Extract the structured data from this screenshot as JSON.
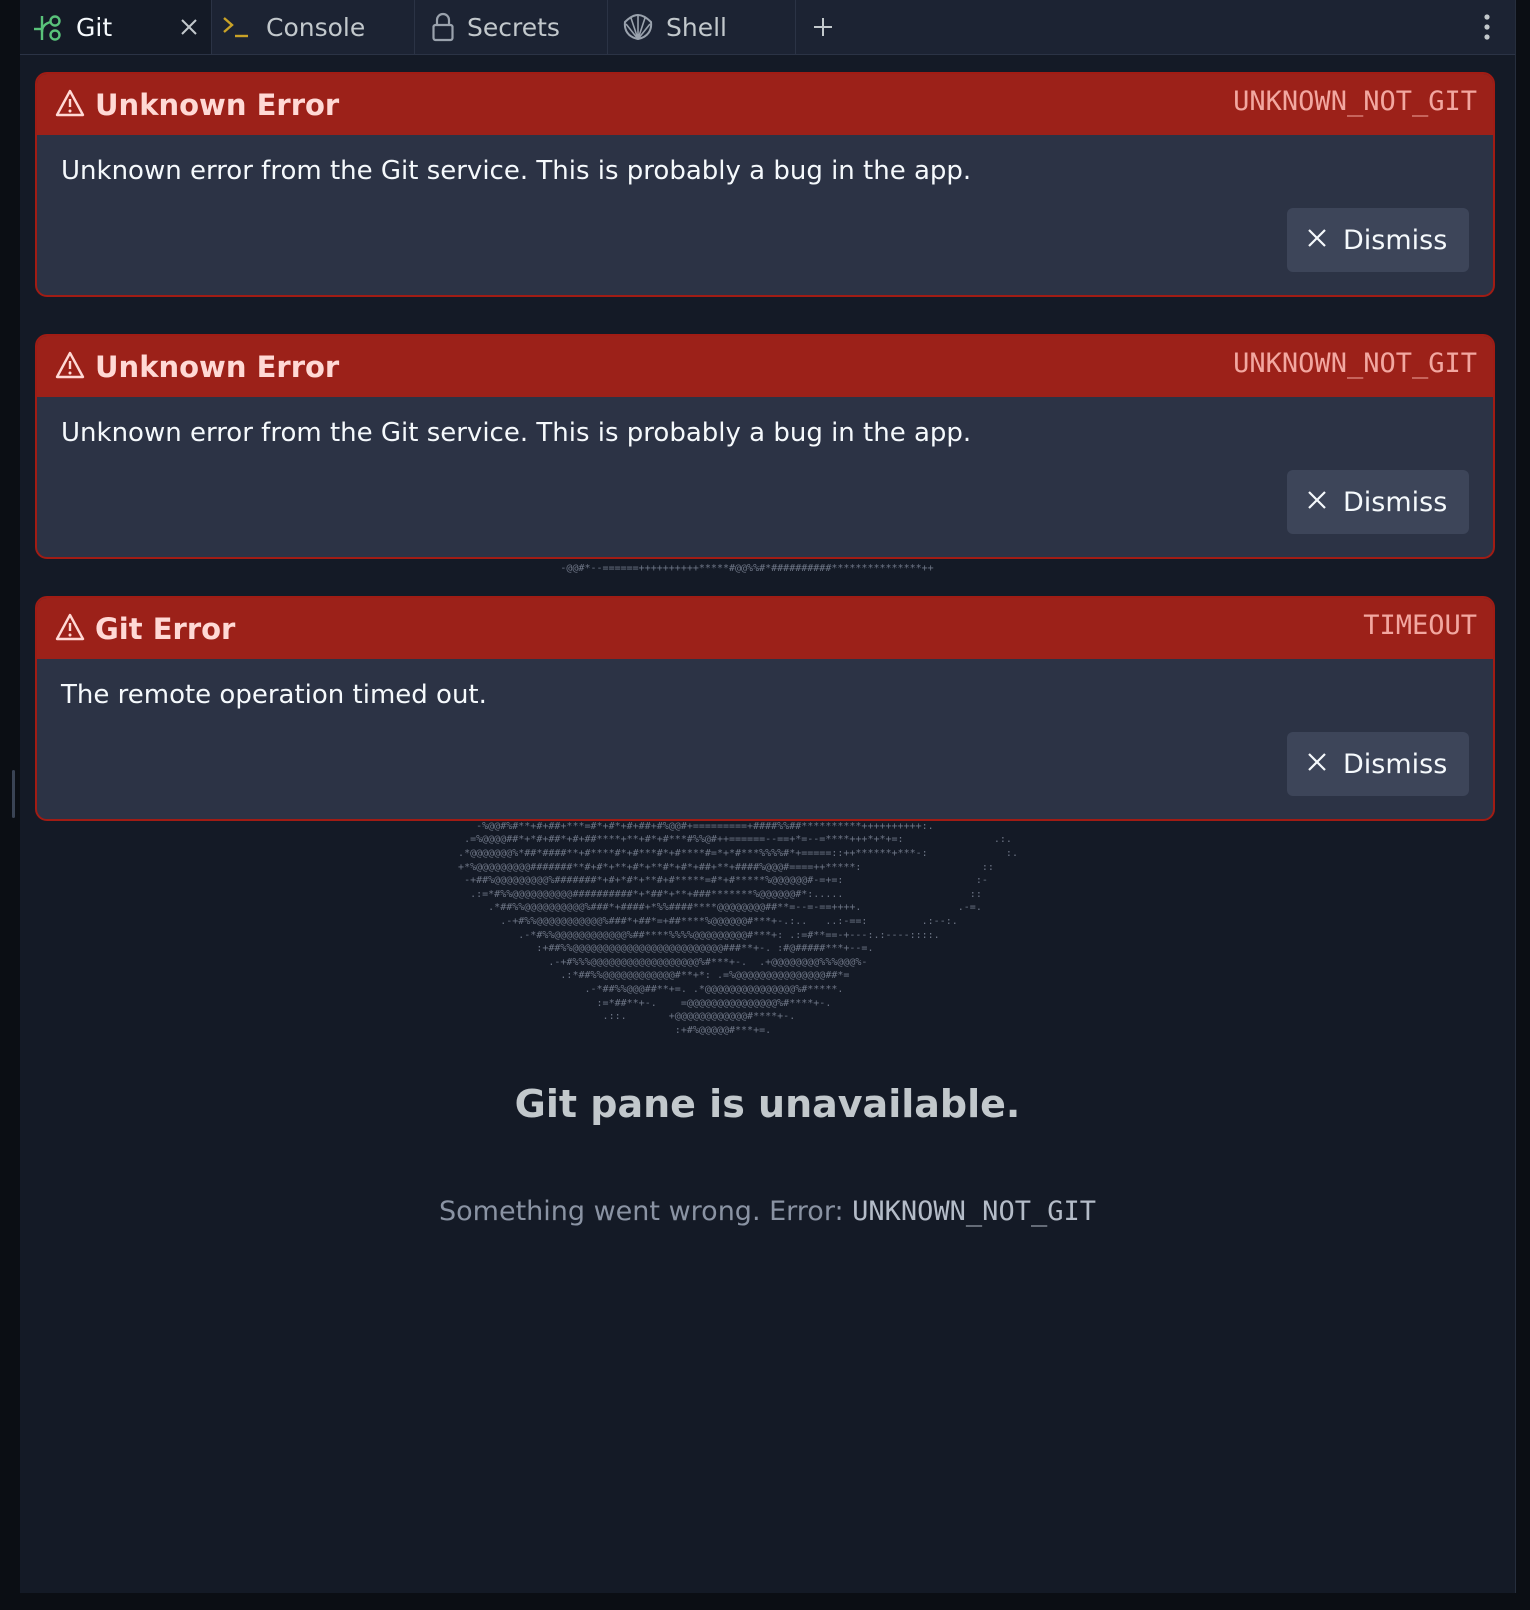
{
  "tabs": [
    {
      "label": "Git",
      "icon": "git-branch-icon",
      "active": true,
      "closable": true
    },
    {
      "label": "Console",
      "icon": "terminal-prompt-icon"
    },
    {
      "label": "Secrets",
      "icon": "lock-icon"
    },
    {
      "label": "Shell",
      "icon": "shell-icon"
    }
  ],
  "errors": [
    {
      "title": "Unknown Error",
      "code": "UNKNOWN_NOT_GIT",
      "message": "Unknown error from the Git service. This is probably a bug in the app.",
      "dismiss_label": "Dismiss"
    },
    {
      "title": "Unknown Error",
      "code": "UNKNOWN_NOT_GIT",
      "message": "Unknown error from the Git service. This is probably a bug in the app.",
      "dismiss_label": "Dismiss"
    },
    {
      "title": "Git Error",
      "code": "TIMEOUT",
      "message": "The remote operation timed out.",
      "dismiss_label": "Dismiss"
    }
  ],
  "ascii_art": "                    -@@#*--====++++++++*****#####%@@@%#*#########***************++\n                    -@@#*--======++++++++++*****#@@%%#*##########***************++\n\n\n\n\n\n\n\n\n\n\n\n\n\n\n\n\n\n      -=*%%%#%*#*##+***++**#**+**#*##%%#*========++*##%##%%@@@@@%#************+*+*++++++++-.\n      -%@@#%#**+#+##+***=#*+#*+#+##+#%@@#+=========+####%%##**********++++++++++:.\n    .=%@@@@##*+*#+##*+#+##****+**+#*+#***#%%@#++======--==+*=--=****+++*+*+=:               .:.\n   .*@@@@@@@%*##*####**+#****#*+#***#*+#****#=*+*#***%%%%#*+=====::++******+***-:             :.\n   +*%@@@@@@@@@#######**#+#*+**+#*+**#*+#*+##+**+####%@@@#====++*****:                    ::\n    -+##%@@@@@@@@@%#######*+#+*#*+**#+#*****=#*+#*****%@@@@@@#-=+=:                      :-\n     .:=*#%%@@@@@@@@@@##########*+*##*+**+###*******%@@@@@@#*:.....                     ::\n        .*##%%@@@@@@@@@@%###*+####+*%%####****@@@@@@@@##**=--=-==++++.                .-=.\n          .-+#%%@@@@@@@@@@@%###*+##*=+##****%@@@@@@#***+-.:..   ..:-==:         .:--:.\n             .-*#%%@@@@@@@@@@@@%##****%%%%@@@@@@@@@#***+: .:=#**==-+---:.:----::::.\n                :+##%%@@@@@@@@@@@@@@@@@@@@@@@@@###**+-. :#@#####***+--=.\n                  .-+#%%%@@@@@@@@@@@@@@@@@@%#***+-.  .+@@@@@@@@%%%@@@%-\n                    .:*##%%@@@@@@@@@@@@#**+*: .=%@@@@@@@@@@@@@@@##*=\n                        .-*##%%@@@##**+=. .*@@@@@@@@@@@@@@@%#*****.\n                          :=*##**+-.    =@@@@@@@@@@@@@@@%#****+-.\n                           .::.       +@@@@@@@@@@@@#****+-.\n                                       :+#%@@@@@#***+=.",
  "unavailable": {
    "title": "Git pane is unavailable.",
    "subtitle_prefix": "Something went wrong. Error:",
    "subtitle_code": "UNKNOWN_NOT_GIT"
  },
  "colors": {
    "error_header": "#9c2119",
    "error_border": "#a11c14",
    "card_body": "#2c3345",
    "background": "#141a26"
  }
}
